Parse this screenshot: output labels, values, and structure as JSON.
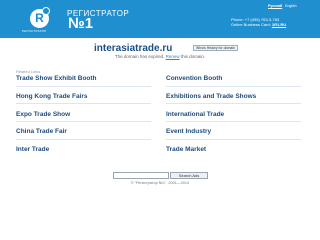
{
  "header": {
    "logo_letter": "R",
    "logo_caption": "РЕГИСТРАТОР",
    "brand_name": "РЕГИСТРАТОР",
    "brand_number": "№1",
    "lang_active": "Русский",
    "lang_other": "English",
    "phone": "Phone: +7 (495) 763-3-763",
    "business_card_label": "Online Business Card:",
    "business_card_value": "1R1.RU",
    "background_color": "#1f8fd0"
  },
  "domain": {
    "name": "interasiatrade.ru",
    "whois_button": "Whois History for domain",
    "expired_text_before": "The domain has expired.",
    "renew_link": "Renew",
    "expired_text_after": "this domain."
  },
  "related": {
    "label": "Related Links",
    "left": [
      "Trade Show Exhibit Booth",
      "Hong Kong Trade Fairs",
      "Expo Trade Show",
      "China Trade Fair",
      "Inter Trade"
    ],
    "right": [
      "Convention Booth",
      "Exhibitions and Trade Shows",
      "International Trade",
      "Event Industry",
      "Trade Market"
    ]
  },
  "search": {
    "input_value": "",
    "button_label": "Search Ads"
  },
  "footer": {
    "copyright": "© \"Регистратор №1\", 2001—2014"
  }
}
